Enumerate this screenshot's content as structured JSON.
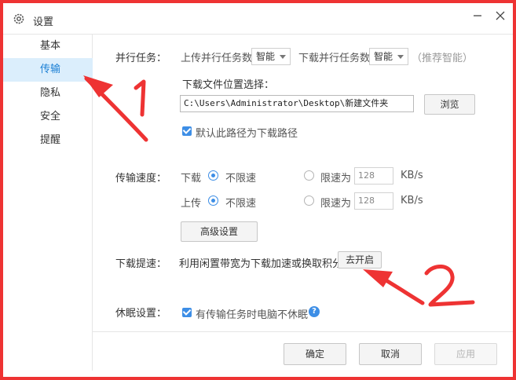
{
  "window": {
    "title": "设置",
    "icons": {
      "app": "gear-icon",
      "minimize": "minimize-icon",
      "close": "close-icon"
    }
  },
  "sidebar": {
    "items": [
      {
        "label": "基本",
        "active": false
      },
      {
        "label": "传输",
        "active": true
      },
      {
        "label": "隐私",
        "active": false
      },
      {
        "label": "安全",
        "active": false
      },
      {
        "label": "提醒",
        "active": false
      }
    ]
  },
  "parallel": {
    "label": "并行任务：",
    "upload_label": "上传并行任务数",
    "upload_value": "智能",
    "download_label": "下载并行任务数",
    "download_value": "智能",
    "hint": "（推荐智能）"
  },
  "location": {
    "label": "下载文件位置选择：",
    "path": "C:\\Users\\Administrator\\Desktop\\新建文件夹",
    "browse_button": "浏览",
    "default_checkbox_label": "默认此路径为下载路径",
    "default_checked": true
  },
  "speed": {
    "label": "传输速度：",
    "download_label": "下载",
    "upload_label": "上传",
    "unlimited_label": "不限速",
    "limit_label": "限速为",
    "download_limit": "128",
    "upload_limit": "128",
    "unit": "KB/s",
    "download_unlimited": true,
    "upload_unlimited": true,
    "advanced_button": "高级设置"
  },
  "boost": {
    "label": "下载提速：",
    "text": "利用闲置带宽为下载加速或换取积分",
    "button": "去开启"
  },
  "sleep": {
    "label": "休眠设置：",
    "checkbox_label": "有传输任务时电脑不休眠",
    "checked": true,
    "help_glyph": "?"
  },
  "footer": {
    "ok": "确定",
    "cancel": "取消",
    "apply": "应用"
  },
  "colors": {
    "accent": "#3d8ee6",
    "active_bg": "#dbeefc",
    "annotation": "#ee3333"
  }
}
